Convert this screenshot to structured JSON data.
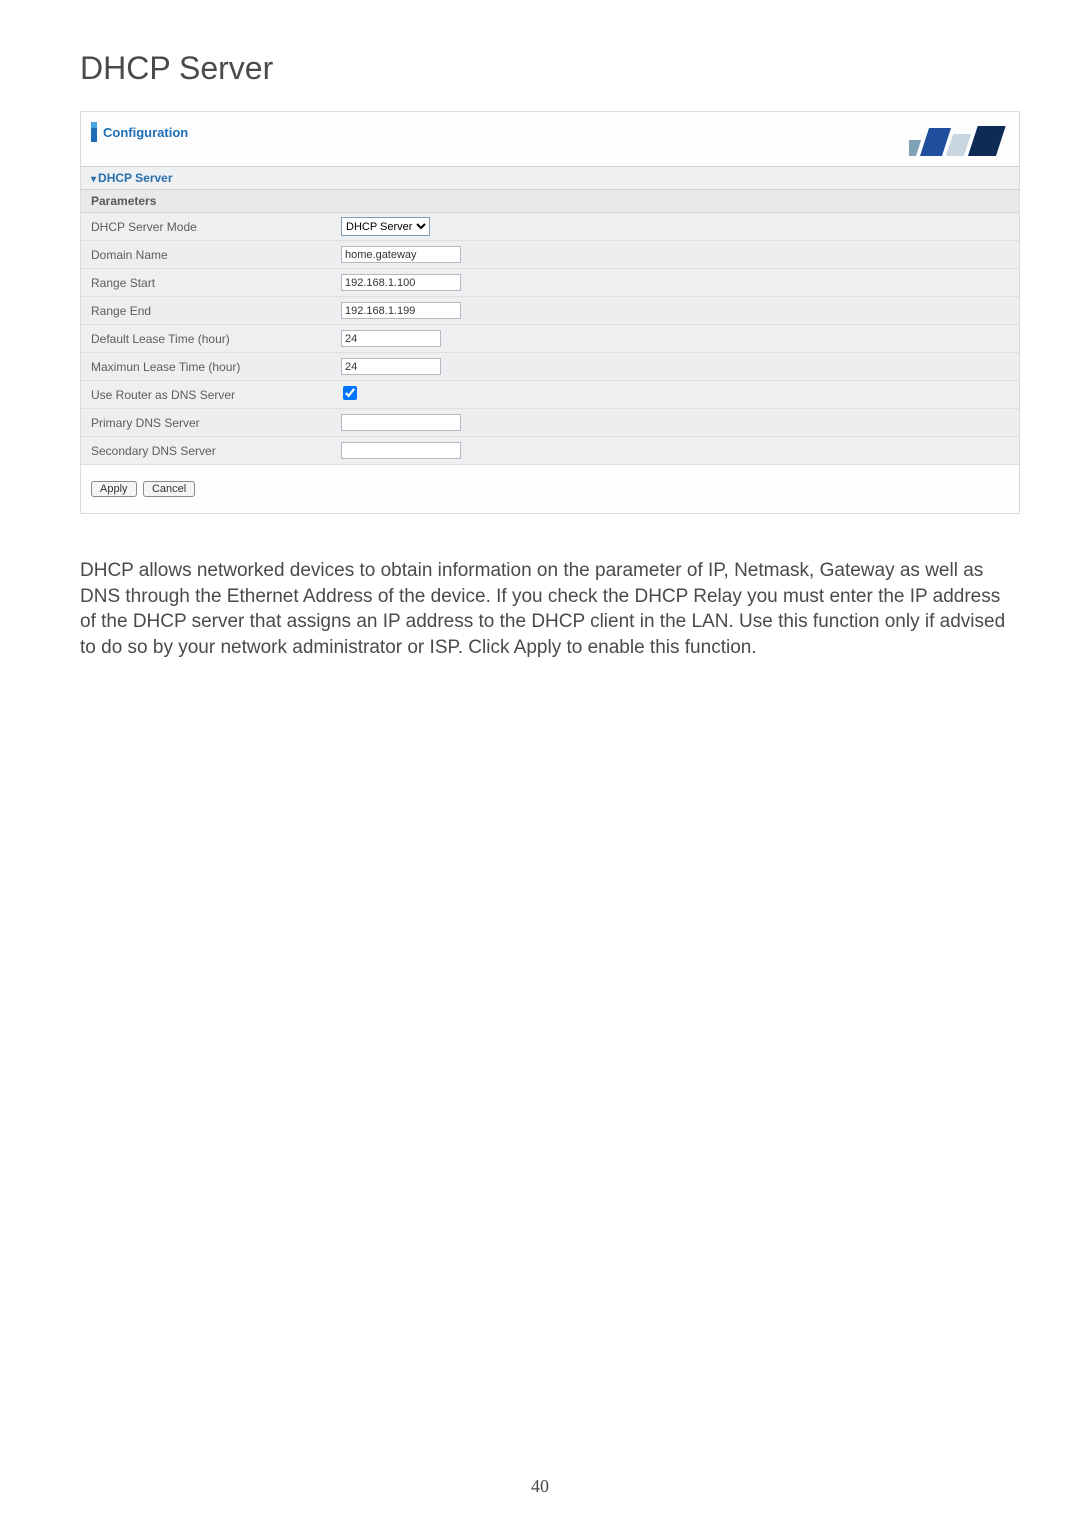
{
  "page": {
    "title": "DHCP Server",
    "number": "40"
  },
  "panel": {
    "config_label": "Configuration",
    "section_title": "DHCP Server",
    "subheader": "Parameters",
    "rows": {
      "mode": {
        "label": "DHCP Server Mode",
        "value": "DHCP Server"
      },
      "domain": {
        "label": "Domain Name",
        "value": "home.gateway"
      },
      "range_start": {
        "label": "Range Start",
        "value": "192.168.1.100"
      },
      "range_end": {
        "label": "Range End",
        "value": "192.168.1.199"
      },
      "default_lease": {
        "label": "Default Lease Time (hour)",
        "value": "24"
      },
      "max_lease": {
        "label": "Maximun Lease Time (hour)",
        "value": "24"
      },
      "use_router_dns": {
        "label": "Use Router as DNS Server",
        "checked": true
      },
      "primary_dns": {
        "label": "Primary DNS Server",
        "value": ""
      },
      "secondary_dns": {
        "label": "Secondary DNS Server",
        "value": ""
      }
    },
    "buttons": {
      "apply": "Apply",
      "cancel": "Cancel"
    }
  },
  "description": "DHCP allows networked devices to obtain information on the parameter of IP, Netmask, Gateway as well as DNS through the Ethernet Address of the device. If you check the DHCP Relay you must enter the IP address of the DHCP server that assigns an IP address to the DHCP client in the LAN. Use this function only if advised to do so by your network administrator or ISP. Click Apply to enable this function."
}
